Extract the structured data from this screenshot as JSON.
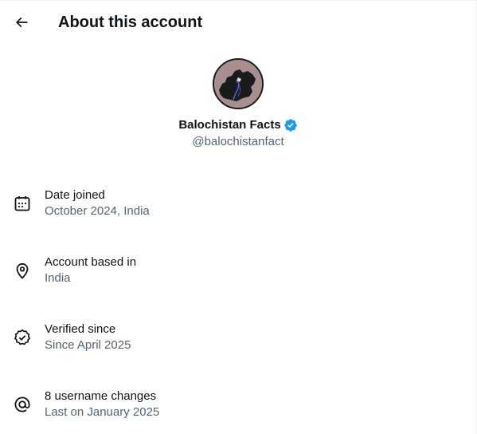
{
  "header": {
    "title": "About this account",
    "back_icon": "arrow-left-icon"
  },
  "profile": {
    "display_name": "Balochistan Facts",
    "handle": "@balochistanfact",
    "verified": true,
    "verified_color": "#1d9bf0",
    "avatar_background": "#a88f8f"
  },
  "info": [
    {
      "icon": "calendar-icon",
      "label": "Date joined",
      "value": "October 2024, India"
    },
    {
      "icon": "location-pin-icon",
      "label": "Account based in",
      "value": "India"
    },
    {
      "icon": "verified-badge-outline-icon",
      "label": "Verified since",
      "value": "Since April 2025"
    },
    {
      "icon": "at-sign-icon",
      "label": "8 username changes",
      "value": "Last on January 2025"
    }
  ],
  "colors": {
    "primary_text": "#0f1419",
    "secondary_text": "#536471"
  }
}
